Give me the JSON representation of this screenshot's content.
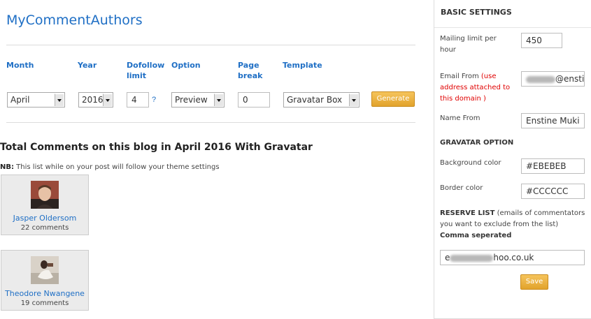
{
  "app_title": "MyCommentAuthors",
  "filters": {
    "labels": {
      "month": "Month",
      "year": "Year",
      "dofollow_line1": "Dofollow",
      "dofollow_line2": "limit",
      "option": "Option",
      "page_break_line1": "Page",
      "page_break_line2": "break",
      "template": "Template"
    },
    "month_value": "April",
    "year_value": "2016",
    "dofollow_value": "4",
    "help_link": "?",
    "option_value": "Preview",
    "page_break_value": "0",
    "template_value": "Gravatar Box",
    "generate_label": "Generate"
  },
  "results": {
    "title": "Total Comments on this blog in April 2016 With Gravatar",
    "note_prefix": "NB:",
    "note_text": " This list while on your post will follow your theme settings",
    "authors": [
      {
        "name": "Jasper Oldersom",
        "comments": "22 comments"
      },
      {
        "name": "Theodore Nwangene",
        "comments": "19 comments"
      }
    ]
  },
  "settings": {
    "title": "BASIC SETTINGS",
    "mailing_label_line1": "Mailing limit per",
    "mailing_label_line2": "hour",
    "mailing_value": "450",
    "email_from_label": "Email From",
    "email_from_hint_line1": "(use",
    "email_from_hint_line2": "address attached to",
    "email_from_hint_line3": "this domain )",
    "email_from_value_suffix": "@enstir",
    "name_from_label": "Name From",
    "name_from_value": "Enstine Muki",
    "gravatar_heading": "GRAVATAR OPTION",
    "bg_color_label": "Background color",
    "bg_color_value": "#EBEBEB",
    "border_color_label": "Border color",
    "border_color_value": "#CCCCCC",
    "reserve_bold": "RESERVE LIST",
    "reserve_text": " (emails of commentators you want to exclude from the list) ",
    "reserve_bold2": "Comma seperated",
    "reserve_value_prefix": "e",
    "reserve_value_suffix": "hoo.co.uk",
    "save_label": "Save"
  },
  "colors": {
    "accent_blue": "#1f6fc5",
    "button_orange": "#e8ac3a",
    "hint_red": "#e00000"
  }
}
